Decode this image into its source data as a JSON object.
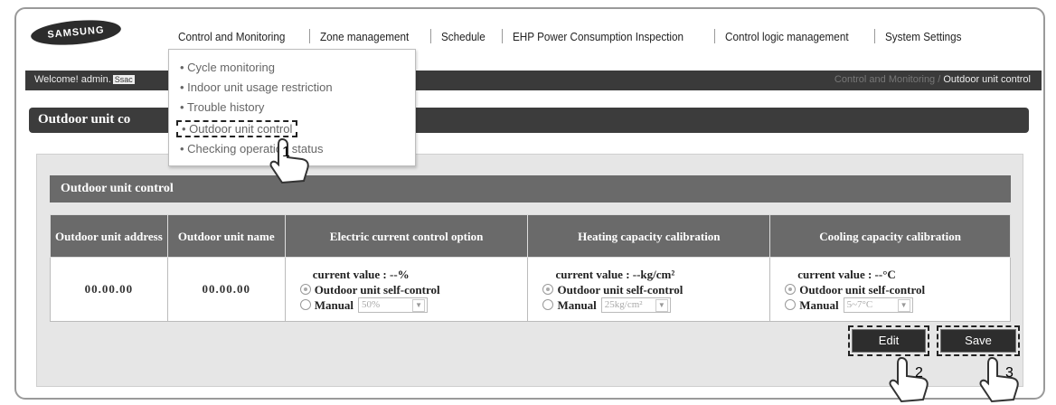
{
  "brand": "SAMSUNG",
  "nav": [
    "Control and Monitoring",
    "Zone management",
    "Schedule",
    "EHP Power Consumption Inspection",
    "Control logic management",
    "System Settings"
  ],
  "welcome": {
    "text": "Welcome! admin.",
    "chip": "Ssac"
  },
  "breadcrumb": {
    "parent": "Control and Monitoring",
    "separator": "/",
    "current": "Outdoor unit control"
  },
  "page_title": "Outdoor unit co",
  "dropdown": {
    "items": [
      "Cycle monitoring",
      "Indoor unit usage restriction",
      "Trouble history",
      "Outdoor unit control",
      "Checking operation status"
    ],
    "selected_index": 3
  },
  "panel": {
    "title": "Outdoor unit control",
    "columns": [
      "Outdoor unit address",
      "Outdoor unit name",
      "Electric current control option",
      "Heating capacity calibration",
      "Cooling capacity calibration"
    ],
    "row": {
      "address": "00.00.00",
      "name": "00.00.00",
      "electric": {
        "current": "current value : --%",
        "self": "Outdoor unit self-control",
        "manual": "Manual",
        "select": "50%"
      },
      "heating": {
        "current": "current value : --kg/cm²",
        "self": "Outdoor unit self-control",
        "manual": "Manual",
        "select": "25kg/cm²"
      },
      "cooling": {
        "current": "current value : --°C",
        "self": "Outdoor unit self-control",
        "manual": "Manual",
        "select": "5~7°C"
      }
    }
  },
  "buttons": {
    "edit": "Edit",
    "save": "Save"
  },
  "markers": [
    "1",
    "2",
    "3"
  ]
}
